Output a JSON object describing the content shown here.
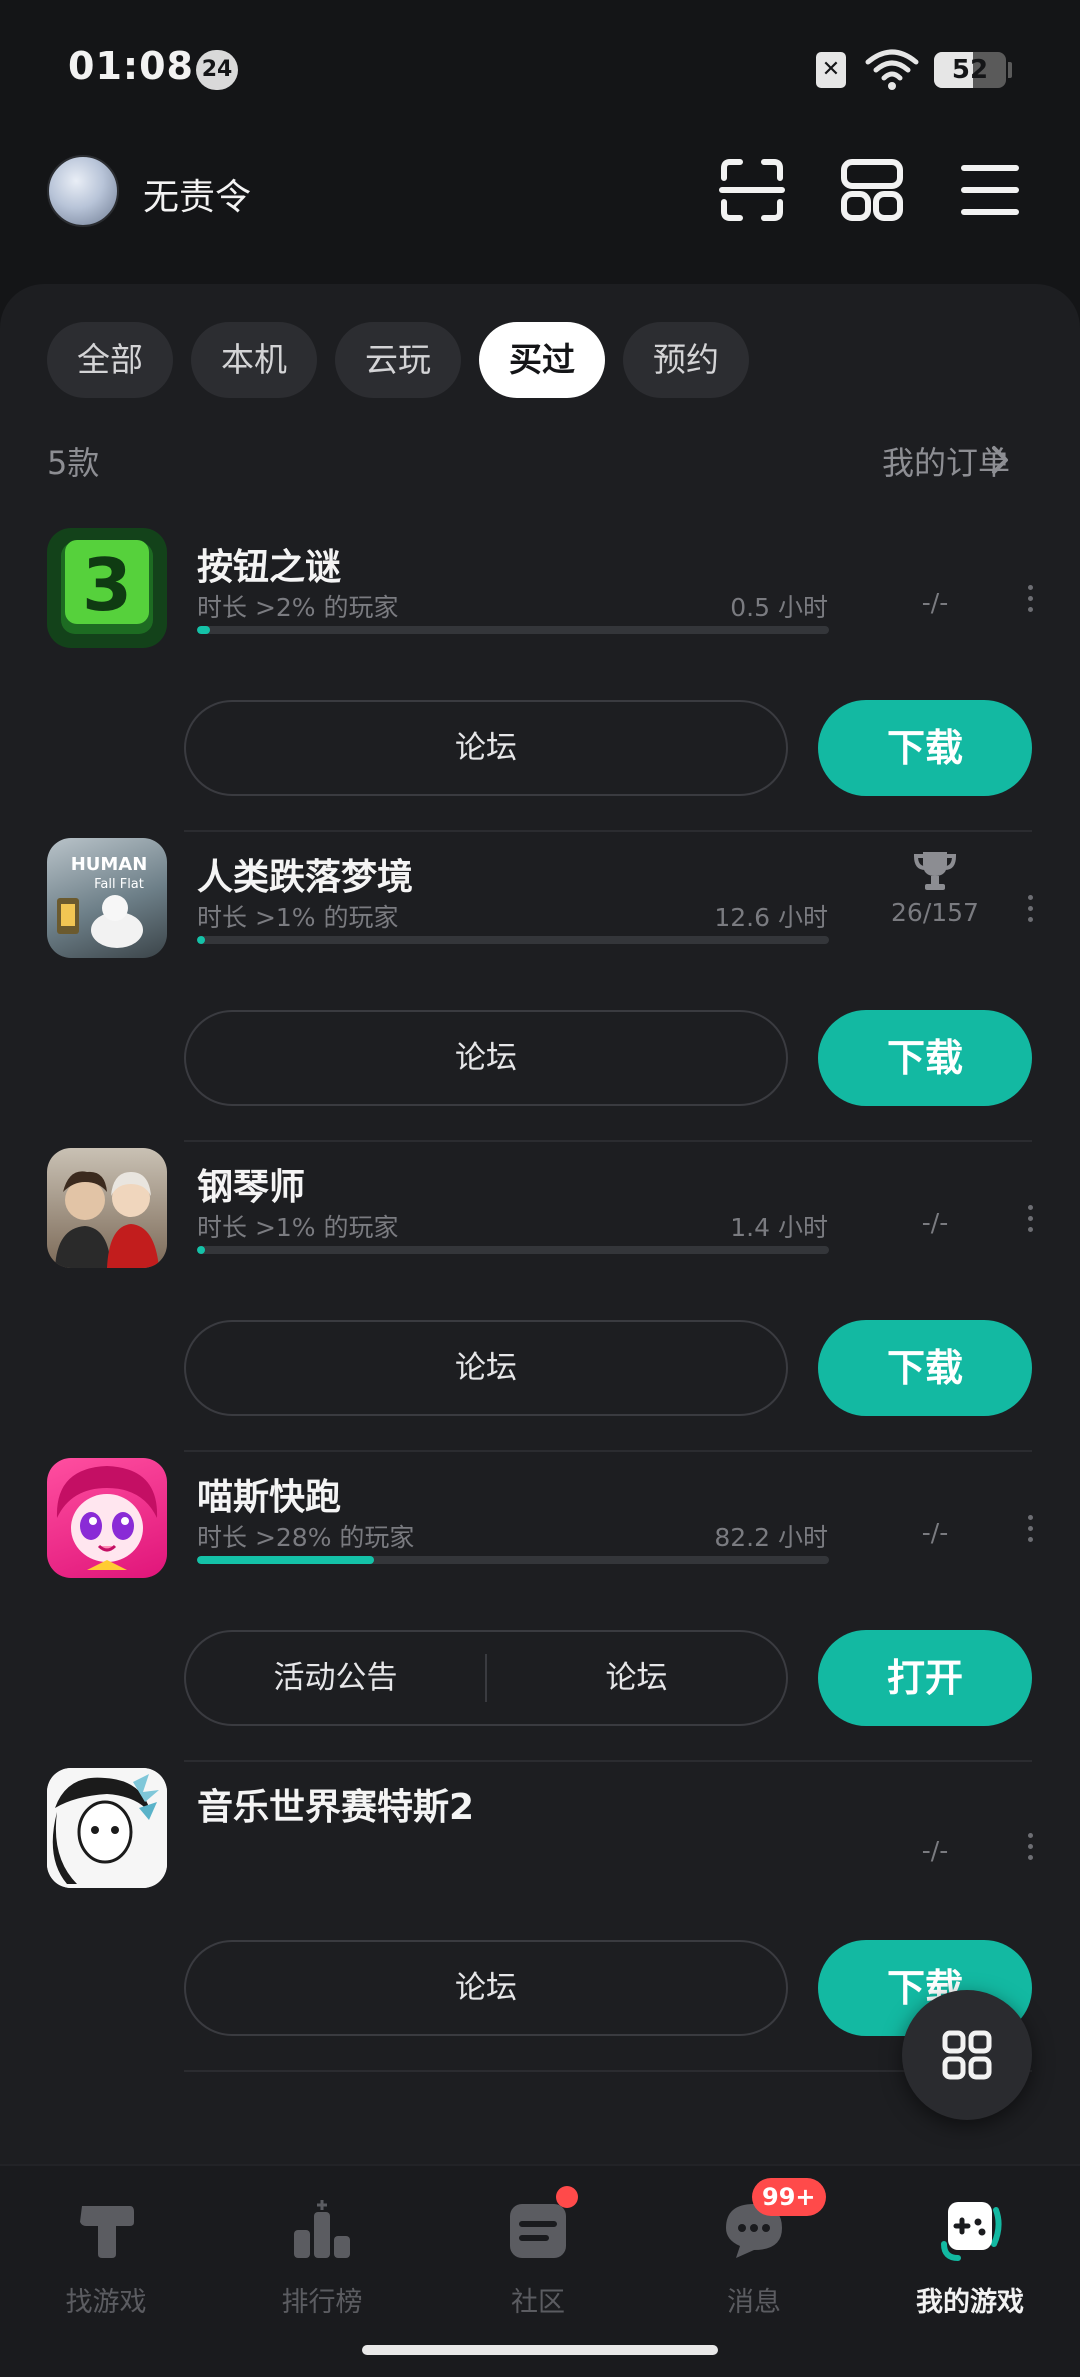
{
  "status_bar": {
    "time": "01:08",
    "notification_count": "24",
    "battery": "52"
  },
  "header": {
    "username": "无责令",
    "icons": [
      "scan-icon",
      "grid-icon",
      "menu-icon"
    ]
  },
  "filter_tabs": [
    {
      "label": "全部",
      "active": false
    },
    {
      "label": "本机",
      "active": false
    },
    {
      "label": "云玩",
      "active": false
    },
    {
      "label": "买过",
      "active": true
    },
    {
      "label": "预约",
      "active": false
    }
  ],
  "summary": {
    "count": "5款",
    "orders_link": "我的订单"
  },
  "games": [
    {
      "title": "按钮之谜",
      "subtitle": "时长 >2% 的玩家",
      "hours": "0.5 小时",
      "progress": 0.02,
      "achievements": "-/-",
      "show_trophy": false,
      "buttons": [
        "论坛"
      ],
      "action": "下载"
    },
    {
      "title": "人类跌落梦境",
      "subtitle": "时长 >1% 的玩家",
      "hours": "12.6 小时",
      "progress": 0.01,
      "achievements": "26/157",
      "show_trophy": true,
      "buttons": [
        "论坛"
      ],
      "action": "下载"
    },
    {
      "title": "钢琴师",
      "subtitle": "时长 >1% 的玩家",
      "hours": "1.4 小时",
      "progress": 0.01,
      "achievements": "-/-",
      "show_trophy": false,
      "buttons": [
        "论坛"
      ],
      "action": "下载"
    },
    {
      "title": "喵斯快跑",
      "subtitle": "时长 >28% 的玩家",
      "hours": "82.2 小时",
      "progress": 0.28,
      "achievements": "-/-",
      "show_trophy": false,
      "buttons": [
        "活动公告",
        "论坛"
      ],
      "action": "打开"
    },
    {
      "title": "音乐世界赛特斯2",
      "subtitle": "",
      "hours": "",
      "progress": null,
      "achievements": "-/-",
      "show_trophy": false,
      "buttons": [
        "论坛"
      ],
      "action": "下载"
    }
  ],
  "bottom_nav": [
    {
      "label": "找游戏",
      "icon": "find-game-icon",
      "active": false
    },
    {
      "label": "排行榜",
      "icon": "ranking-icon",
      "active": false
    },
    {
      "label": "社区",
      "icon": "community-icon",
      "active": false
    },
    {
      "label": "消息",
      "icon": "message-icon",
      "active": false
    },
    {
      "label": "我的游戏",
      "icon": "my-games-icon",
      "active": true
    }
  ],
  "badges": {
    "messages": "99+"
  },
  "colors": {
    "accent": "#13b9a2",
    "background": "#141517",
    "panel": "#1d1e21",
    "badge": "#ff4a4a"
  }
}
